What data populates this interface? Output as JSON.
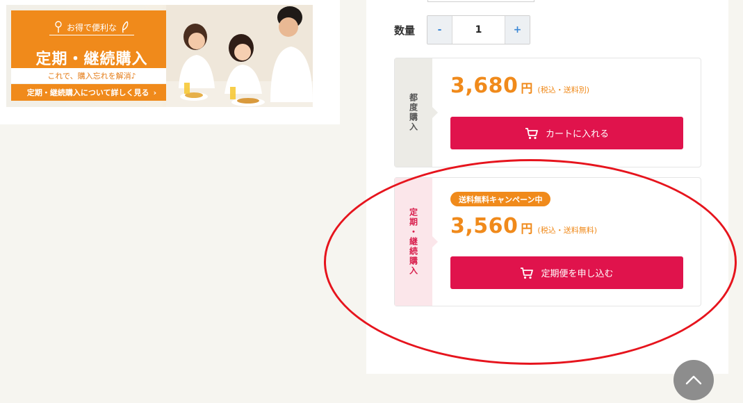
{
  "banner": {
    "subtitle": "お得で便利な",
    "title": "定期・継続購入",
    "caption": "これで、購入忘れを解消♪",
    "cta_label": "定期・継続購入について詳しく見る",
    "cta_chevron": "›"
  },
  "quantity": {
    "label": "数量",
    "minus": "-",
    "value": "1",
    "plus": "+"
  },
  "single_purchase": {
    "side_label": "都度購入",
    "price": "3,680",
    "currency": "円",
    "tax_note": "(税込・送料別)",
    "button_label": "カートに入れる",
    "button_icon": "cart-icon"
  },
  "subscription": {
    "side_label": "定期・継続購入",
    "badge": "送料無料キャンペーン中",
    "price": "3,560",
    "currency": "円",
    "tax_note": "(税込・送料無料)",
    "button_label": "定期便を申し込む",
    "button_icon": "cart-icon"
  },
  "colors": {
    "accent_orange": "#f08a1b",
    "cta_red": "#e0134c",
    "highlight_circle": "#e6141d"
  }
}
